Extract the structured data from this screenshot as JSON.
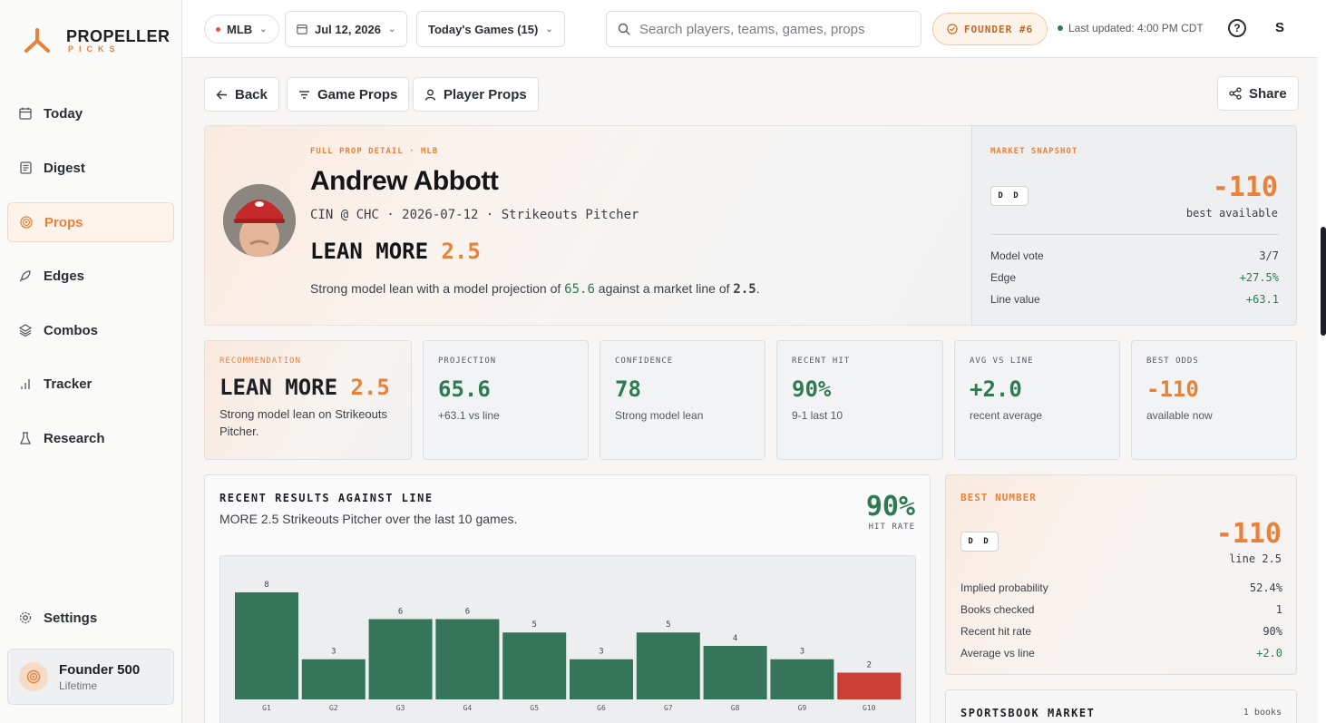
{
  "brand": {
    "title": "PROPELLER",
    "subtitle": "PICKS",
    "accent": "#e8823a"
  },
  "sidebar": {
    "items": [
      {
        "label": "Today",
        "icon": "calendar-icon"
      },
      {
        "label": "Digest",
        "icon": "newspaper-icon"
      },
      {
        "label": "Props",
        "icon": "target-icon",
        "active": true
      },
      {
        "label": "Edges",
        "icon": "rocket-icon"
      },
      {
        "label": "Combos",
        "icon": "layers-icon"
      },
      {
        "label": "Tracker",
        "icon": "bar-chart-icon"
      },
      {
        "label": "Research",
        "icon": "flask-icon"
      }
    ],
    "settings_label": "Settings",
    "founder": {
      "title": "Founder 500",
      "sub": "Lifetime"
    }
  },
  "topbar": {
    "league": "MLB",
    "date": "Jul 12, 2026",
    "games": "Today's Games (15)",
    "search_placeholder": "Search players, teams, games, props",
    "founder_badge": "FOUNDER #6",
    "updated": "Last updated: 4:00 PM CDT",
    "help": "?",
    "avatar": "S"
  },
  "actions": {
    "back": "Back",
    "game_props": "Game Props",
    "player_props": "Player Props",
    "share": "Share"
  },
  "hero": {
    "eyebrow": "FULL PROP DETAIL · MLB",
    "name": "Andrew Abbott",
    "meta": "CIN @ CHC · 2026-07-12 · Strikeouts Pitcher",
    "lean_word": "LEAN MORE",
    "lean_line": "2.5",
    "desc_pre": "Strong model lean with a model projection of",
    "desc_proj": "65.6",
    "desc_mid": "against a market line of",
    "desc_line": "2.5",
    "desc_end": "."
  },
  "snapshot": {
    "title": "MARKET SNAPSHOT",
    "book": "D D",
    "odds": "-110",
    "odds_label": "best available",
    "rows": [
      {
        "label": "Model vote",
        "value": "3/7"
      },
      {
        "label": "Edge",
        "value": "+27.5%"
      },
      {
        "label": "Line value",
        "value": "+63.1"
      }
    ]
  },
  "stats": [
    {
      "label": "RECOMMENDATION",
      "value_word": "LEAN MORE",
      "value_num": "2.5",
      "sub": "Strong model lean on Strikeouts Pitcher."
    },
    {
      "label": "PROJECTION",
      "value": "65.6",
      "sub": "+63.1 vs line"
    },
    {
      "label": "CONFIDENCE",
      "value": "78",
      "sub": "Strong model lean"
    },
    {
      "label": "RECENT HIT",
      "value": "90%",
      "sub": "9-1 last 10"
    },
    {
      "label": "AVG VS LINE",
      "value": "+2.0",
      "sub": "recent average"
    },
    {
      "label": "BEST ODDS",
      "value": "-110",
      "sub": "available now"
    }
  ],
  "results": {
    "title": "RECENT RESULTS AGAINST LINE",
    "sub": "MORE 2.5 Strikeouts Pitcher over the last 10 games.",
    "hit_rate": "90%",
    "hit_rate_label": "HIT RATE"
  },
  "chart_data": {
    "type": "bar",
    "categories": [
      "G1",
      "G2",
      "G3",
      "G4",
      "G5",
      "G6",
      "G7",
      "G8",
      "G9",
      "G10"
    ],
    "values": [
      8,
      3,
      6,
      6,
      5,
      3,
      5,
      4,
      3,
      2
    ],
    "line": 2.5,
    "hit_color": "#35765a",
    "miss_color": "#cc3d34",
    "ylim": [
      0,
      9
    ]
  },
  "best_number": {
    "title": "BEST NUMBER",
    "book": "D D",
    "odds": "-110",
    "line_label": "line 2.5",
    "rows": [
      {
        "label": "Implied probability",
        "value": "52.4%"
      },
      {
        "label": "Books checked",
        "value": "1"
      },
      {
        "label": "Recent hit rate",
        "value": "90%"
      },
      {
        "label": "Average vs line",
        "value": "+2.0"
      }
    ]
  },
  "sportsbook": {
    "title": "SPORTSBOOK MARKET",
    "count": "1 books"
  }
}
